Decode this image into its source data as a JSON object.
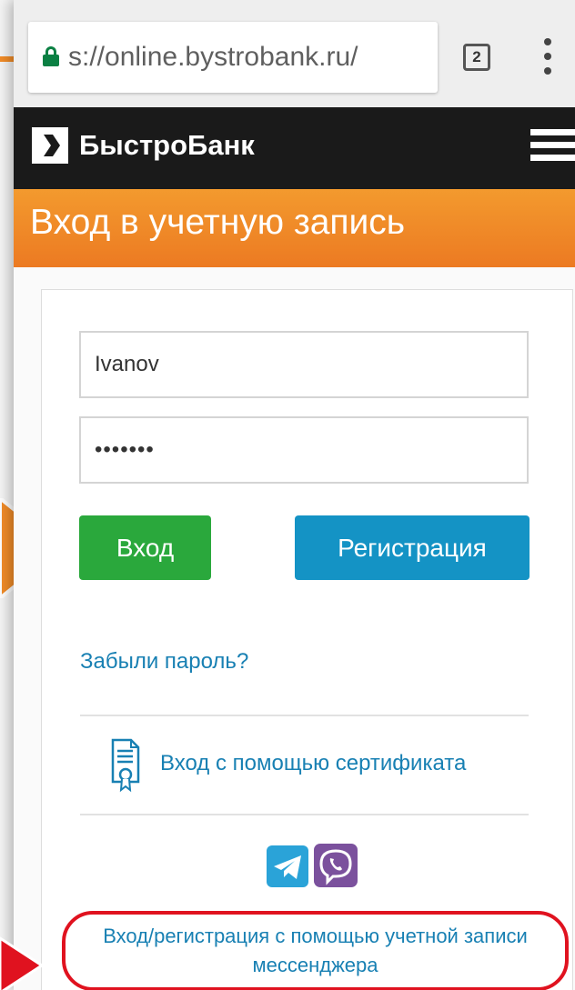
{
  "browser": {
    "url": "s://online.bystrobank.ru/",
    "tab_count": "2",
    "icons": [
      "lock-icon",
      "tabs-icon",
      "more-vert-icon"
    ]
  },
  "site": {
    "brand": "БыстроБанк",
    "logo_icon": "chevron-right-icon",
    "menu_icon": "hamburger-icon"
  },
  "page": {
    "title": "Вход в учетную запись"
  },
  "login_form": {
    "login_value": "Ivanov",
    "password_value": "•••••••",
    "login_button": "Вход",
    "register_button": "Регистрация",
    "forgot_link": "Забыли пароль?",
    "certificate_link": "Вход с помощью сертификата",
    "messenger_link": "Вход/регистрация с помощью учетной записи мессенджера",
    "messenger_icons": [
      "telegram-icon",
      "viber-icon"
    ]
  },
  "colors": {
    "header_bg": "#1a1a1a",
    "title_bar": "#ef8a27",
    "login_button": "#2aa83c",
    "register_button": "#1493c5",
    "link": "#1880b3",
    "highlight_frame": "#e0121f",
    "annotation_arrow": "#f28c28"
  }
}
